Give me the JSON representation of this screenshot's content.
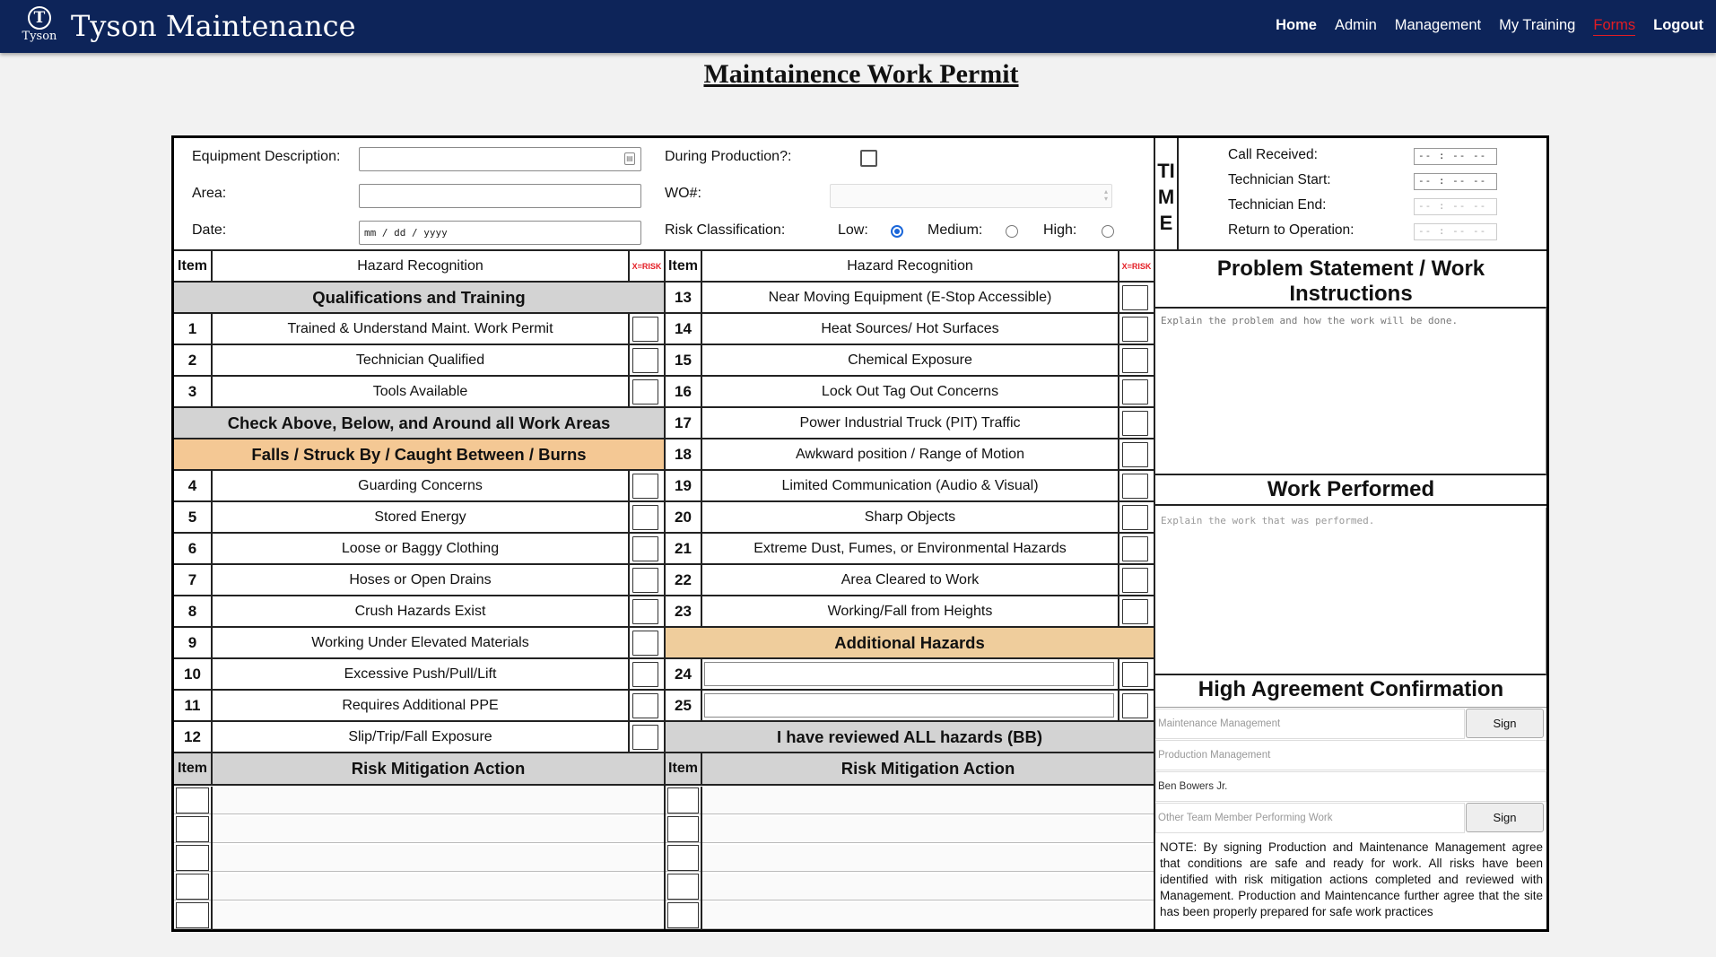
{
  "nav": {
    "logo_symbol": "T",
    "logo_word": "Tyson",
    "brand": "Tyson Maintenance",
    "links": [
      "Home",
      "Admin",
      "Management",
      "My Training",
      "Forms",
      "Logout"
    ]
  },
  "page_title": "Maintainence Work Permit",
  "header_form": {
    "equipment_label": "Equipment Description:",
    "area_label": "Area:",
    "date_label": "Date:",
    "date_placeholder": "mm / dd / yyyy",
    "during_production_label": "During Production?:",
    "wo_label": "WO#:",
    "risk_label": "Risk Classification:",
    "risk_options": [
      "Low:",
      "Medium:",
      "High:"
    ],
    "risk_selected": "Low"
  },
  "time": {
    "side_label": [
      "TI",
      "M",
      "E"
    ],
    "fields": [
      {
        "label": "Call Received:",
        "value": "-- : --  --"
      },
      {
        "label": "Technician Start:",
        "value": "-- : --  --"
      },
      {
        "label": "Technician End:",
        "value": "-- : --  --"
      },
      {
        "label": "Return to Operation:",
        "value": "-- : --  --"
      }
    ]
  },
  "hazard_table": {
    "col_item": "Item",
    "col_hazard": "Hazard Recognition",
    "col_risk": "X=RISK",
    "left": {
      "section_qual": "Qualifications and Training",
      "items_qual": [
        {
          "num": "1",
          "text": "Trained & Understand Maint. Work Permit"
        },
        {
          "num": "2",
          "text": "Technician Qualified"
        },
        {
          "num": "3",
          "text": "Tools Available"
        }
      ],
      "section_check": "Check Above, Below, and Around all Work Areas",
      "section_falls": "Falls / Struck By / Caught Between / Burns",
      "items_falls": [
        {
          "num": "4",
          "text": "Guarding Concerns"
        },
        {
          "num": "5",
          "text": "Stored Energy"
        },
        {
          "num": "6",
          "text": "Loose or Baggy Clothing"
        },
        {
          "num": "7",
          "text": "Hoses or Open Drains"
        },
        {
          "num": "8",
          "text": "Crush Hazards Exist"
        },
        {
          "num": "9",
          "text": "Working Under Elevated Materials"
        },
        {
          "num": "10",
          "text": "Excessive Push/Pull/Lift"
        },
        {
          "num": "11",
          "text": "Requires Additional PPE"
        },
        {
          "num": "12",
          "text": "Slip/Trip/Fall Exposure"
        }
      ]
    },
    "right": {
      "items": [
        {
          "num": "13",
          "text": "Near Moving Equipment (E-Stop Accessible)"
        },
        {
          "num": "14",
          "text": "Heat Sources/ Hot Surfaces"
        },
        {
          "num": "15",
          "text": "Chemical Exposure"
        },
        {
          "num": "16",
          "text": "Lock Out Tag Out Concerns"
        },
        {
          "num": "17",
          "text": "Power Industrial Truck (PIT) Traffic"
        },
        {
          "num": "18",
          "text": "Awkward position / Range of Motion"
        },
        {
          "num": "19",
          "text": "Limited Communication (Audio & Visual)"
        },
        {
          "num": "20",
          "text": "Sharp Objects"
        },
        {
          "num": "21",
          "text": "Extreme Dust, Fumes, or Environmental Hazards"
        },
        {
          "num": "22",
          "text": "Area Cleared to Work"
        },
        {
          "num": "23",
          "text": "Working/Fall from Heights"
        }
      ],
      "section_additional": "Additional Hazards",
      "additional": [
        {
          "num": "24"
        },
        {
          "num": "25"
        }
      ],
      "reviewed": "I have reviewed ALL hazards (BB)"
    }
  },
  "mitigation": {
    "col_item": "Item",
    "title": "Risk Mitigation Action"
  },
  "problem": {
    "title": "Problem Statement / Work Instructions",
    "placeholder": "Explain the problem and how the work will be done."
  },
  "work_performed": {
    "title": "Work Performed",
    "placeholder": "Explain the work that was performed."
  },
  "agreement": {
    "title": "High Agreement Confirmation",
    "fields": [
      {
        "placeholder": "Maintenance Management",
        "button": "Sign"
      },
      {
        "placeholder": "Production Management"
      },
      {
        "value": "Ben Bowers Jr."
      },
      {
        "placeholder": "Other Team Member Performing Work",
        "button": "Sign"
      }
    ],
    "note": "NOTE: By signing Production and Maintenance Management agree that conditions are safe and ready for work. All risks have been identified with risk mitigation actions completed and reviewed with Management. Production and Maintencance further agree that the site has been properly prepared for safe work practices"
  },
  "colors": {
    "nav_bg": "#0d2459",
    "active_link": "#e31c23",
    "section_gray": "#d3d3d3",
    "section_tan": "#f4c894",
    "radio_blue": "#1a66d9"
  }
}
